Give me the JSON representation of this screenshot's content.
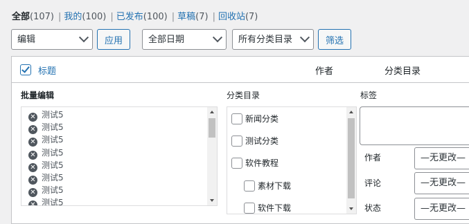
{
  "filters": [
    {
      "label": "全部",
      "count": "(107)"
    },
    {
      "label": "我的",
      "count": "(100)"
    },
    {
      "label": "已发布",
      "count": "(100)"
    },
    {
      "label": "草稿",
      "count": "(7)"
    },
    {
      "label": "回收站",
      "count": "(7)"
    }
  ],
  "bulk_action": {
    "selected": "编辑",
    "apply_label": "应用"
  },
  "date_filter": {
    "selected": "全部日期"
  },
  "category_filter": {
    "selected": "所有分类目录"
  },
  "filter_button_label": "筛选",
  "table_header": {
    "title": "标题",
    "author": "作者",
    "category": "分类目录",
    "select_all_checked": true
  },
  "bulk_edit": {
    "legend": "批量编辑",
    "posts": [
      "测试5",
      "测试5",
      "测试5",
      "测试5",
      "测试5",
      "测试5",
      "测试5",
      "测试5"
    ]
  },
  "categories": {
    "legend": "分类目录",
    "items": [
      {
        "label": "新闻分类",
        "level": 0
      },
      {
        "label": "测试分类",
        "level": 0
      },
      {
        "label": "软件教程",
        "level": 0
      },
      {
        "label": "素材下载",
        "level": 1
      },
      {
        "label": "软件下载",
        "level": 1
      }
    ]
  },
  "tags": {
    "legend": "标签"
  },
  "fields": [
    {
      "label": "作者",
      "value": "—无更改—"
    },
    {
      "label": "评论",
      "value": "—无更改—"
    },
    {
      "label": "状态",
      "value": "—无更改—"
    }
  ],
  "colors": {
    "link": "#2271b1",
    "border": "#c3c4c7",
    "background": "#f0f0f1"
  }
}
